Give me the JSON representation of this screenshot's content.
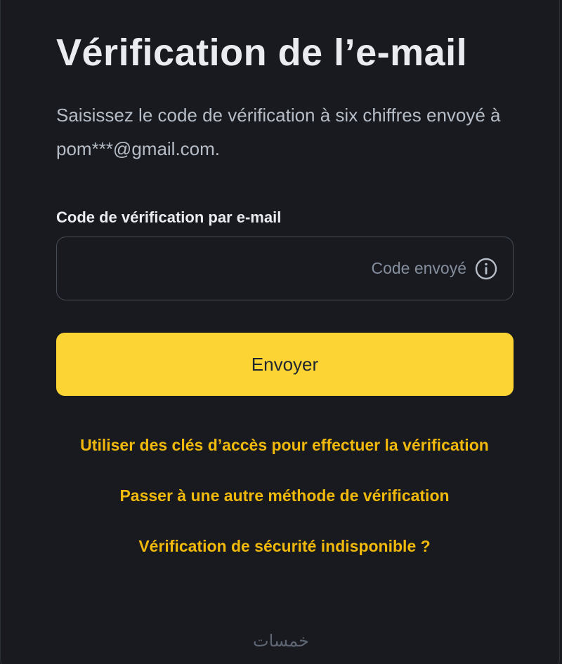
{
  "page": {
    "title": "Vérification de l’e-mail",
    "subtitle": "Saisissez le code de vérification à six chiffres envoyé à pom***@gmail.com."
  },
  "form": {
    "code_label": "Code de vérification par e-mail",
    "code_value": "",
    "code_status": "Code envoyé",
    "status_icon": "info-icon",
    "submit_label": "Envoyer"
  },
  "links": {
    "passkeys": "Utiliser des clés d’accès pour effectuer la vérification",
    "other_method": "Passer à une autre méthode de vérification",
    "security_unavailable": "Vérification de sécurité indisponible ?"
  },
  "watermark": "خمسات",
  "colors": {
    "background": "#181a20",
    "accent": "#fcd535",
    "link": "#f0b90b",
    "text_primary": "#eaecef",
    "text_secondary": "#b7bdc6",
    "text_muted": "#848e9c",
    "border": "#474d57"
  }
}
